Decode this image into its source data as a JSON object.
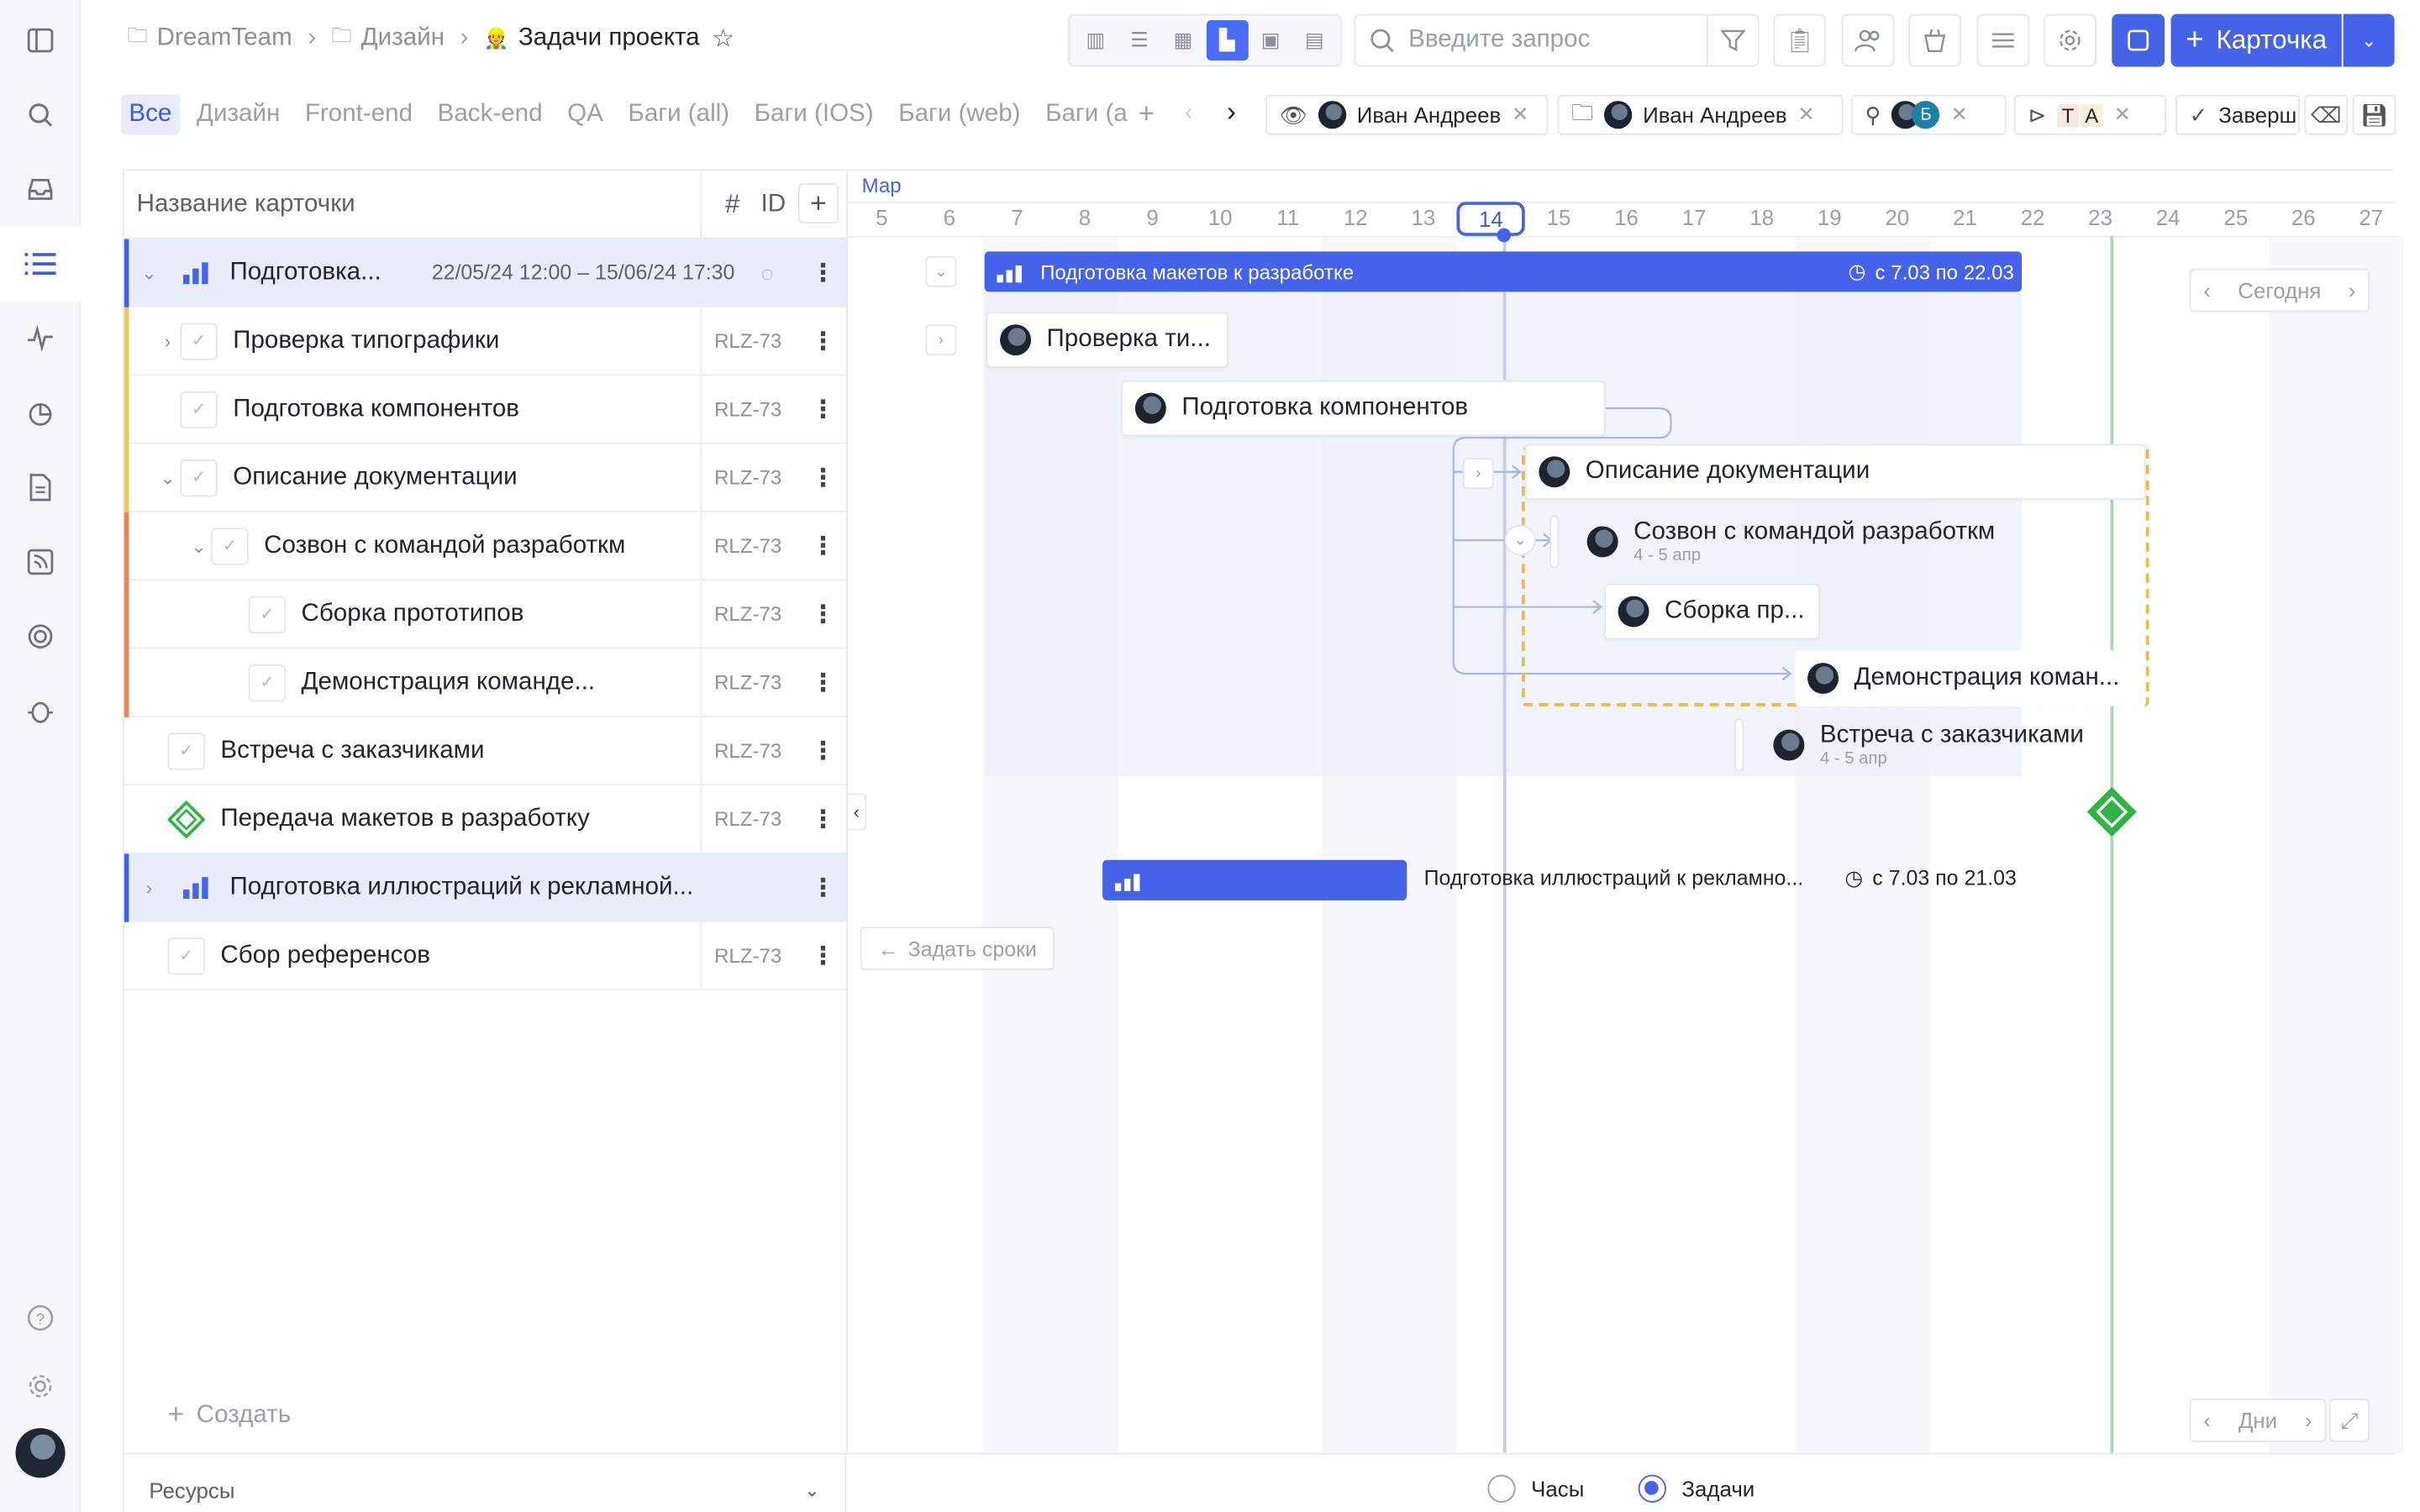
{
  "breadcrumb": {
    "team": "DreamTeam",
    "folder": "Дизайн",
    "project": "Задачи проекта"
  },
  "search": {
    "placeholder": "Введите запрос"
  },
  "toolbar": {
    "create_label": "Карточка"
  },
  "tabs": [
    "Все",
    "Дизайн",
    "Front-end",
    "Back-end",
    "QA",
    "Баги (all)",
    "Баги (IOS)",
    "Баги (web)",
    "Баги (a"
  ],
  "filters": {
    "watcher": "Иван Андреев",
    "owner": "Иван Андреев",
    "members_initial": "Б",
    "tags": [
      "Т",
      "А"
    ],
    "status": "Заверш"
  },
  "list": {
    "header_name": "Название карточки",
    "header_hash": "#",
    "header_id": "ID",
    "rows": [
      {
        "title": "Подготовка...",
        "dates": "22/05/24 12:00 – 15/06/24 17:30",
        "id": ""
      },
      {
        "title": "Проверка типографики",
        "id": "RLZ-73"
      },
      {
        "title": "Подготовка компонентов",
        "id": "RLZ-73"
      },
      {
        "title": "Описание документации",
        "id": "RLZ-73"
      },
      {
        "title": "Созвон с командой разработкм",
        "id": "RLZ-73"
      },
      {
        "title": "Сборка прототипов",
        "id": "RLZ-73"
      },
      {
        "title": "Демонстрация команде...",
        "id": "RLZ-73"
      },
      {
        "title": "Встреча с заказчиками",
        "id": "RLZ-73"
      },
      {
        "title": "Передача макетов в разработку",
        "id": "RLZ-73"
      },
      {
        "title": "Подготовка иллюстраций к рекламной...",
        "id": ""
      },
      {
        "title": "Сбор референсов",
        "id": "RLZ-73"
      }
    ],
    "create_label": "Создать",
    "resources_label": "Ресурсы"
  },
  "gantt": {
    "month": "Мар",
    "days": [
      "5",
      "6",
      "7",
      "8",
      "9",
      "10",
      "11",
      "12",
      "13",
      "14",
      "15",
      "16",
      "17",
      "18",
      "19",
      "20",
      "21",
      "22",
      "23",
      "24",
      "25",
      "26",
      "27"
    ],
    "today_day": "14",
    "bar1": {
      "title": "Подготовка макетов к разработке",
      "range": "с 7.03 по 22.03"
    },
    "tasks": {
      "t1": "Проверка ти...",
      "t2": "Подготовка компонентов",
      "t3": "Описание документации",
      "t4": "Созвон с командой разработкм",
      "t4_sub": "4 - 5 апр",
      "t5": "Сборка пр...",
      "t6": "Демонстрация коман...",
      "t7": "Встреча с заказчиками",
      "t7_sub": "4 - 5 апр"
    },
    "bar2": {
      "title": "Подготовка иллюстраций к рекламно...",
      "range": "с 7.03 по 21.03"
    },
    "set_dates_label": "Задать сроки",
    "today_label": "Сегодня",
    "scale_label": "Дни"
  },
  "footer": {
    "hours_label": "Часы",
    "tasks_label": "Задачи",
    "mode": "Задачи"
  },
  "colors": {
    "accent": "#4563e8",
    "milestone": "#2fb344",
    "selection": "#f0b94a"
  }
}
